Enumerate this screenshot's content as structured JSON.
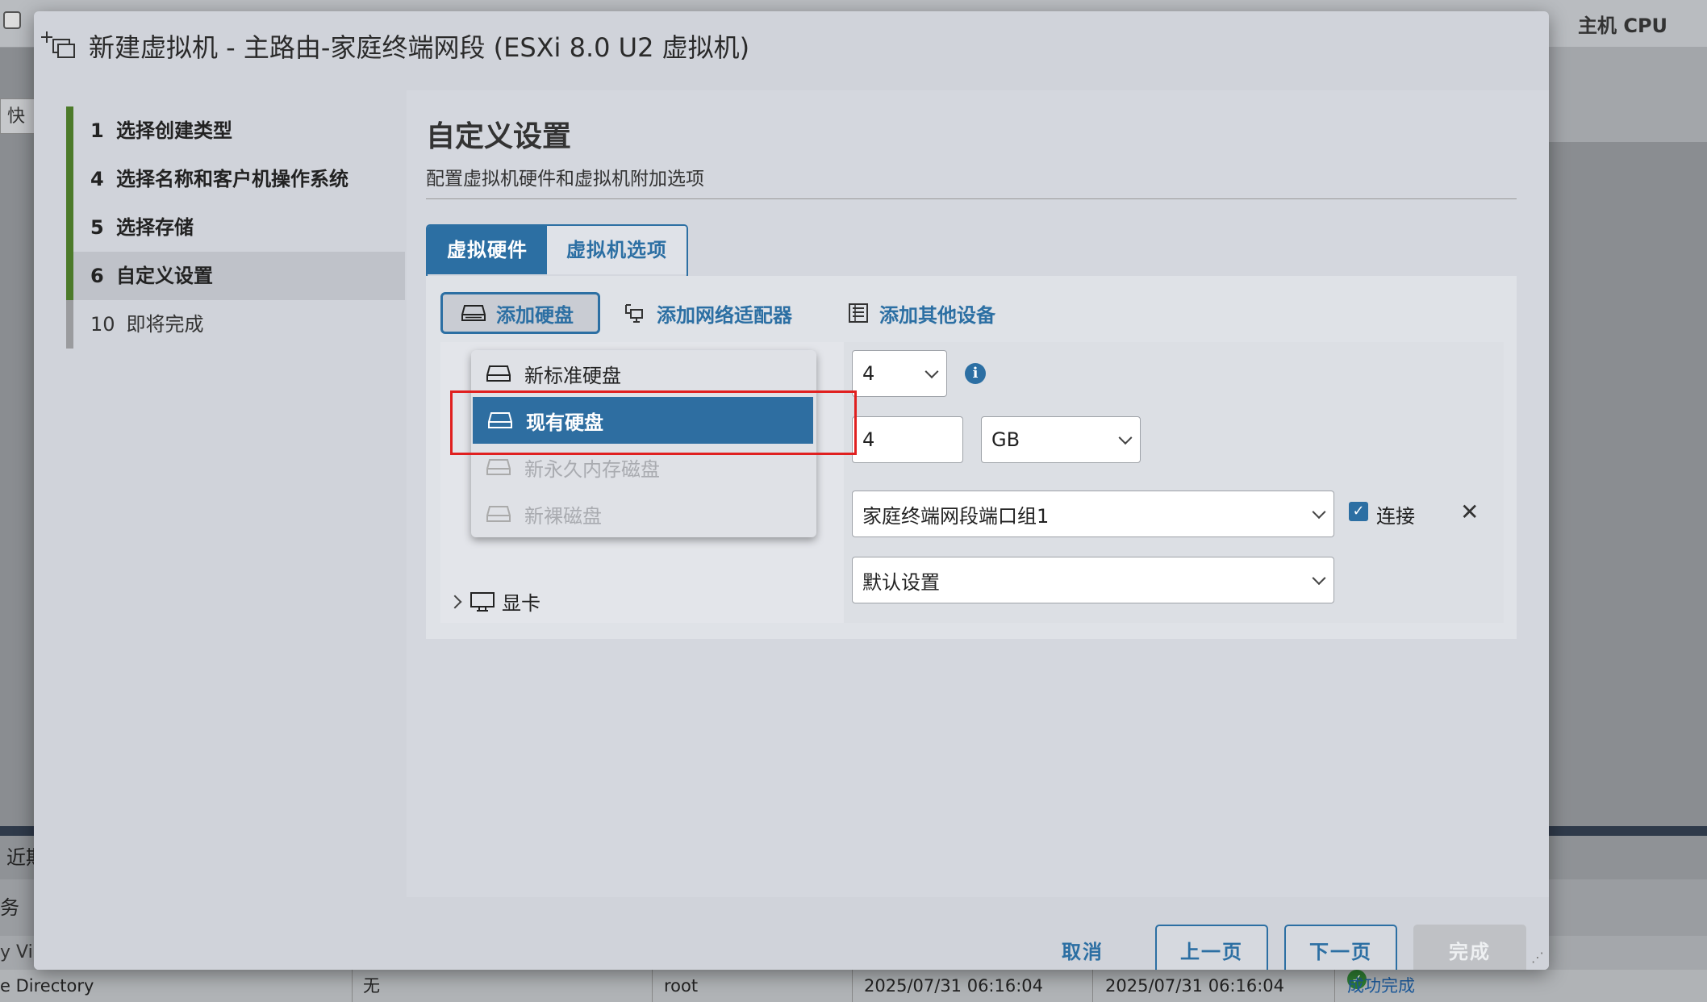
{
  "background": {
    "host_cpu_label": "主机 CPU",
    "quick_label": "快速",
    "recent_label": "近期",
    "header_fragment": "务",
    "row1_fragment": "y Vi",
    "row2": {
      "task": "e Directory",
      "target": "无",
      "user": "root",
      "queued": "2025/07/31 06:16:04",
      "started": "2025/07/31 06:16:04",
      "status": "成功完成"
    }
  },
  "modal": {
    "title": "新建虚拟机 - 主路由-家庭终端网段 (ESXi 8.0 U2 虚拟机)",
    "steps": [
      {
        "num": "1",
        "label": "选择创建类型"
      },
      {
        "num": "4",
        "label": "选择名称和客户机操作系统"
      },
      {
        "num": "5",
        "label": "选择存储"
      },
      {
        "num": "6",
        "label": "自定义设置"
      },
      {
        "num": "10",
        "label": "即将完成"
      }
    ],
    "page_title": "自定义设置",
    "page_subtitle": "配置虚拟机硬件和虚拟机附加选项",
    "tabs": [
      "虚拟硬件",
      "虚拟机选项"
    ],
    "toolbar": {
      "add_disk": "添加硬盘",
      "add_network": "添加网络适配器",
      "add_other": "添加其他设备"
    },
    "add_disk_menu": [
      {
        "label": "新标准硬盘",
        "state": "normal"
      },
      {
        "label": "现有硬盘",
        "state": "selected"
      },
      {
        "label": "新永久内存磁盘",
        "state": "disabled"
      },
      {
        "label": "新裸磁盘",
        "state": "disabled"
      }
    ],
    "rows": {
      "cpu_value": "4",
      "memory_value": "4",
      "memory_unit": "GB",
      "network_value": "家庭终端网段端口组1",
      "connect_label": "连接",
      "display_label": "显卡",
      "display_value": "默认设置"
    },
    "footer": {
      "cancel": "取消",
      "back": "上一页",
      "next": "下一页",
      "finish": "完成"
    }
  }
}
